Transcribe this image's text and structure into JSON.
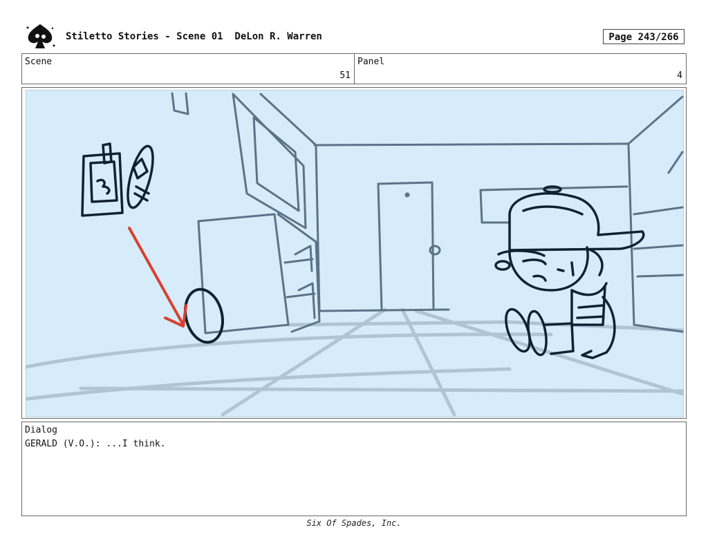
{
  "header": {
    "title": "Stiletto Stories - Scene 01  DeLon R. Warren",
    "page": "Page 243/266",
    "logo_icon": "spade-logo-icon"
  },
  "scene": {
    "label": "Scene",
    "value": "51"
  },
  "panel": {
    "label": "Panel",
    "value": "4"
  },
  "dialog": {
    "label": "Dialog",
    "text": "GERALD (V.O.): ...I think."
  },
  "footer": {
    "text": "Six Of Spades, Inc."
  },
  "colors": {
    "sketch_bg": "#d6ecfa",
    "sketch_line": "#5b7288",
    "ink": "#0f2233",
    "arrow": "#d9402e"
  }
}
